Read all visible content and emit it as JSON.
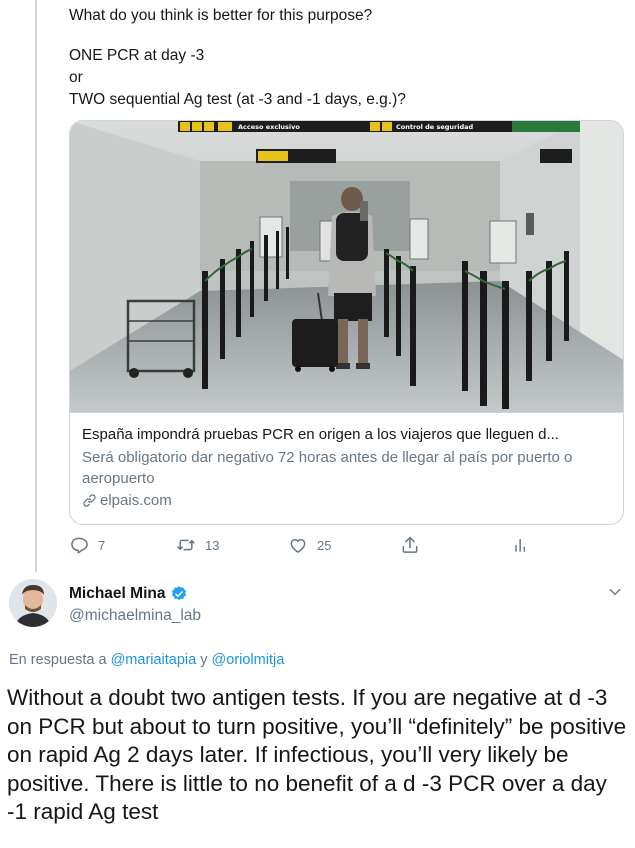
{
  "parent_tweet": {
    "lines": [
      "What do you think is better for this purpose?",
      "ONE PCR at day -3",
      "or",
      "TWO sequential Ag test (at -3 and -1 days, e.g.)?"
    ],
    "card": {
      "image_icon": "airport-photo",
      "image_signs": [
        "Acceso exclusivo",
        "Control de seguridad"
      ],
      "title": "España impondrá pruebas PCR en origen a los viajeros que lleguen d...",
      "description": "Será obligatorio dar negativo 72 horas antes de llegar al país por puerto o aeropuerto",
      "domain": "elpais.com"
    },
    "actions": {
      "reply_count": "7",
      "retweet_count": "13",
      "like_count": "25"
    }
  },
  "reply_tweet": {
    "author_name": "Michael Mina",
    "author_handle": "@michaelmina_lab",
    "reply_prefix": "En respuesta a",
    "mention_1": "@mariaitapia",
    "reply_joiner": "y",
    "mention_2": "@oriolmitja",
    "text": "Without a doubt two antigen tests. If you are negative at d -3 on PCR but about to turn positive, you’ll “definitely” be positive on rapid Ag 2 days later. If infectious, you’ll very likely be positive. There is little to no benefit of a d -3 PCR over a day -1 rapid Ag test"
  },
  "colors": {
    "text": "#14171a",
    "secondary": "#657786",
    "link": "#1b95e0",
    "border": "#ccd6dd",
    "verified": "#1da1f2"
  }
}
